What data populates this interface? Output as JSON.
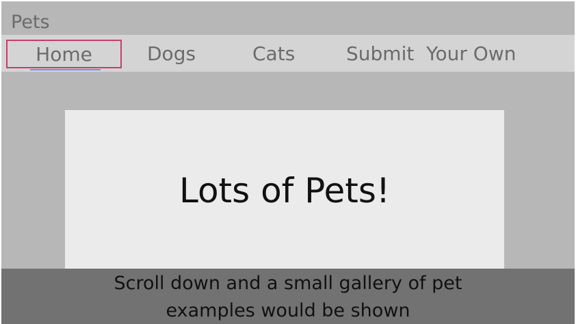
{
  "app": {
    "title": "Pets"
  },
  "nav": {
    "items": [
      {
        "label": "Home",
        "active": true
      },
      {
        "label": "Dogs",
        "active": false
      },
      {
        "label": "Cats",
        "active": false
      },
      {
        "label": "Submit  Your Own",
        "active": false
      }
    ]
  },
  "hero": {
    "title": "Lots of Pets!"
  },
  "annotation": {
    "text": "Scroll down and a small gallery of pet\nexamples would be shown"
  },
  "colors": {
    "page_background": "#b7b7b7",
    "navbar_background": "#d4d4d4",
    "hero_background": "#ebebeb",
    "annotation_background": "#727272",
    "active_outline": "#c2406e",
    "active_underline": "#6f8ff0",
    "nav_text": "#6b6b6b"
  }
}
